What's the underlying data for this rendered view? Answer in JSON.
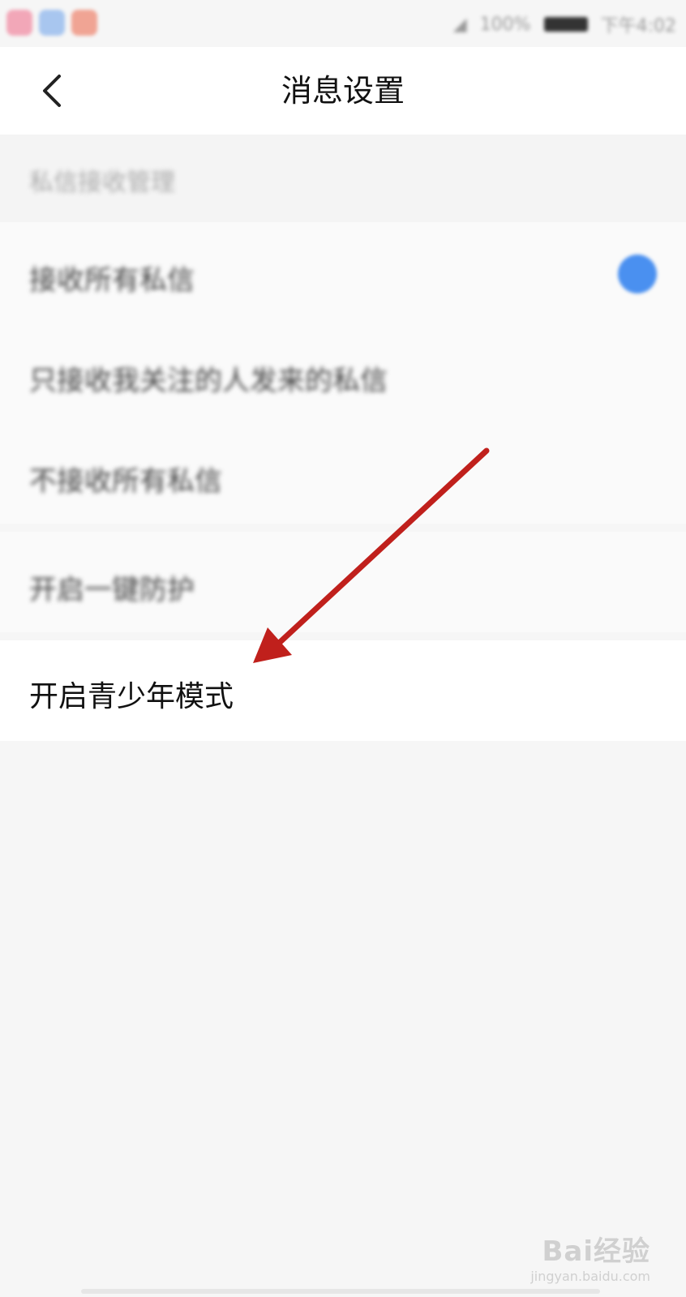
{
  "status_bar": {
    "time": "下午4:02",
    "battery": "100%"
  },
  "header": {
    "title": "消息设置",
    "back_icon": "chevron-left-icon"
  },
  "section": {
    "title": "私信接收管理"
  },
  "options": [
    {
      "label": "接收所有私信",
      "selected": true
    },
    {
      "label": "只接收我关注的人发来的私信",
      "selected": false
    },
    {
      "label": "不接收所有私信",
      "selected": false
    }
  ],
  "protection": {
    "label": "开启一键防护"
  },
  "youth_mode": {
    "label": "开启青少年模式"
  },
  "watermark": {
    "main": "Bai经验",
    "sub": "jingyan.baidu.com"
  },
  "colors": {
    "accent": "#4a90f0",
    "annotation_arrow": "#c0201c"
  }
}
